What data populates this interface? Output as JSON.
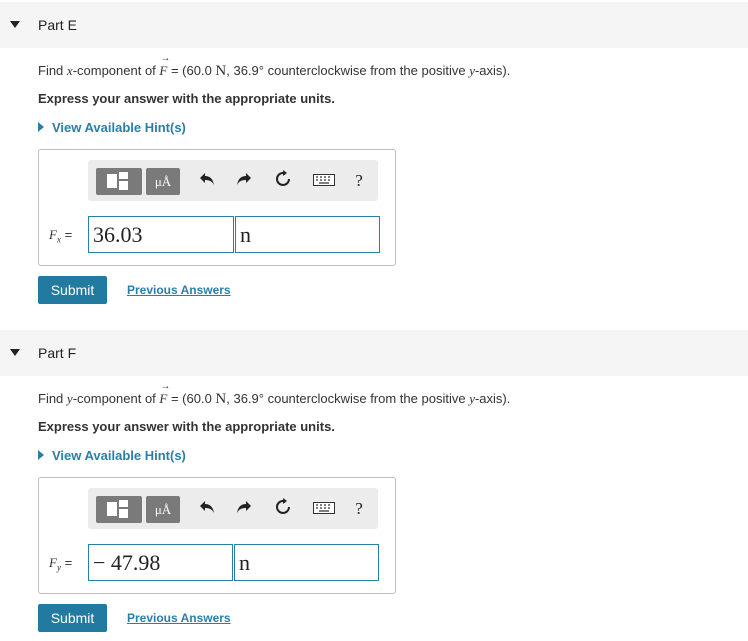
{
  "partE": {
    "title": "Part E",
    "question_prefix": "Find ",
    "component_var": "x",
    "question_mid": "-component of ",
    "force_symbol": "F",
    "question_eq": " = (60.0 ",
    "newton": "N",
    "question_suffix": ", 36.9° counterclockwise from the positive ",
    "axis_var": "y",
    "question_end": "-axis).",
    "instruction": "Express your answer with the appropriate units.",
    "hint": "View Available Hint(s)",
    "units_button": "μÅ",
    "answer_label_var": "F",
    "answer_label_sub": "x",
    "answer_label_eq": " =",
    "value": "36.03",
    "unit": "n",
    "submit": "Submit",
    "previous": "Previous Answers"
  },
  "partF": {
    "title": "Part F",
    "question_prefix": "Find ",
    "component_var": "y",
    "question_mid": "-component of ",
    "force_symbol": "F",
    "question_eq": " = (60.0 ",
    "newton": "N",
    "question_suffix": ", 36.9° counterclockwise from the positive ",
    "axis_var": "y",
    "question_end": "-axis).",
    "instruction": "Express your answer with the appropriate units.",
    "hint": "View Available Hint(s)",
    "units_button": "μÅ",
    "answer_label_var": "F",
    "answer_label_sub": "y",
    "answer_label_eq": " =",
    "value": "− 47.98",
    "unit": "n",
    "submit": "Submit",
    "previous": "Previous Answers"
  },
  "toolbar": {
    "undo_icon": "undo-icon",
    "redo_icon": "redo-icon",
    "reset_icon": "reset-icon",
    "keyboard_icon": "keyboard-icon",
    "help_label": "?"
  }
}
